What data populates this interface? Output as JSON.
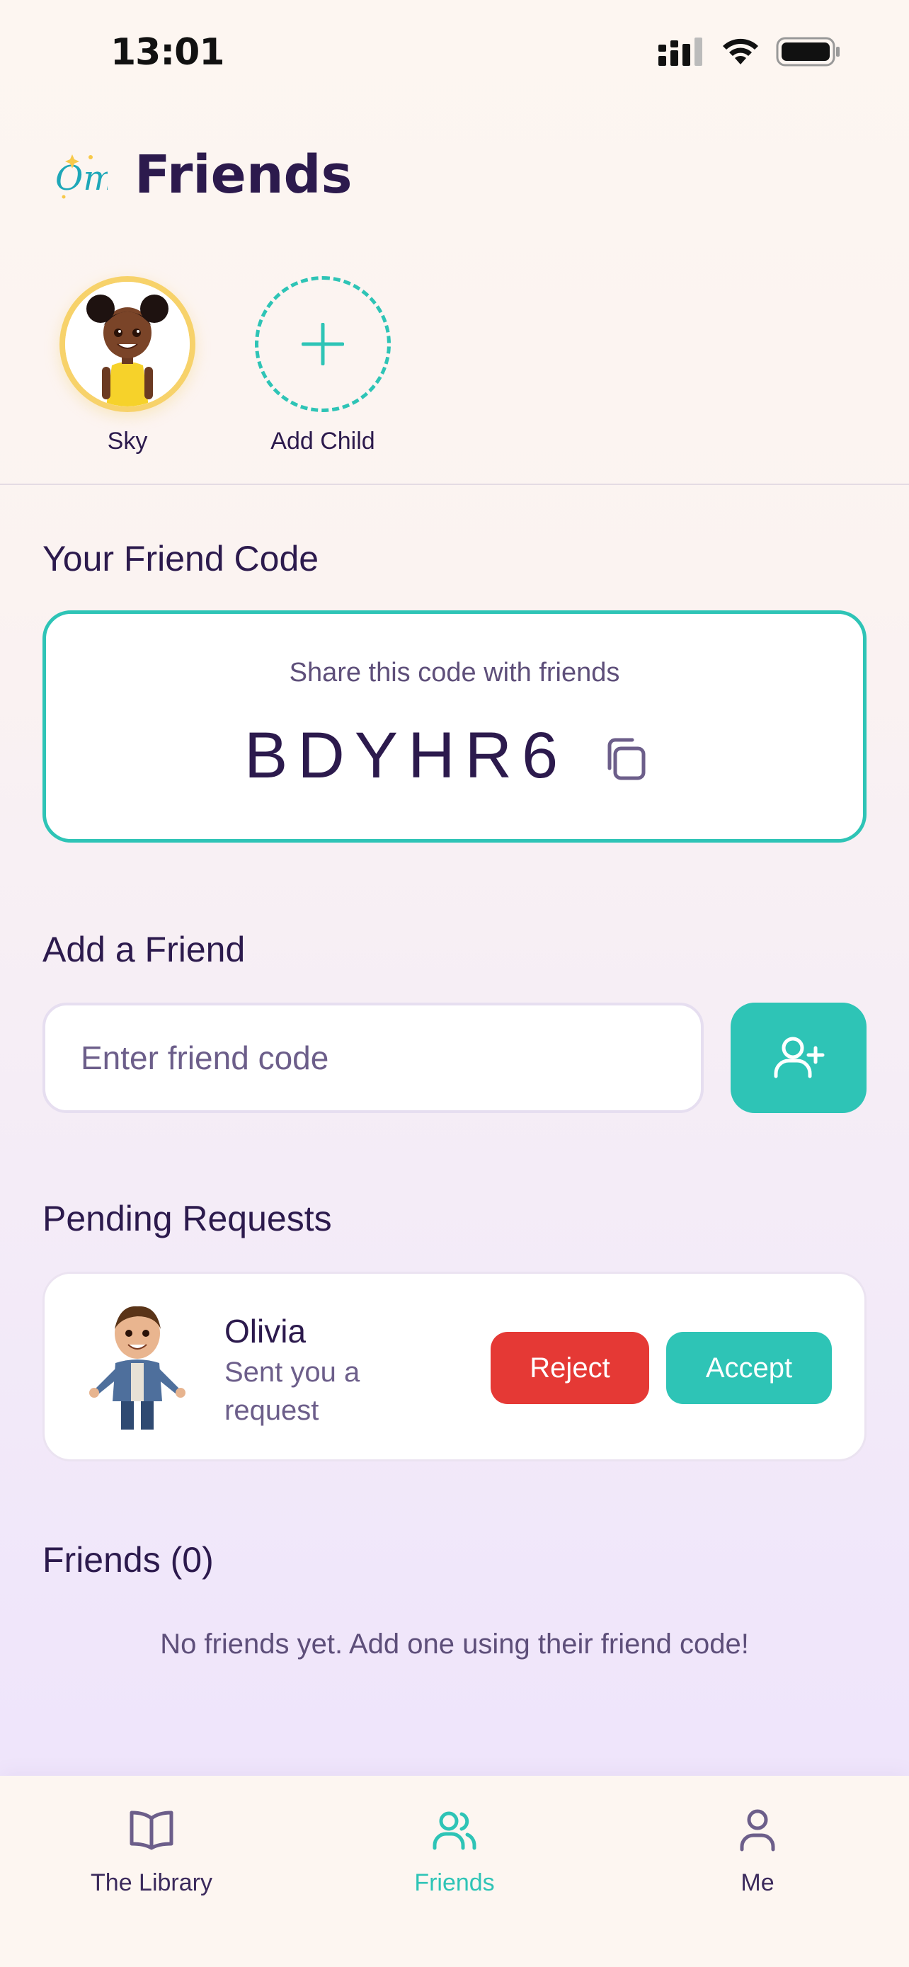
{
  "status_bar": {
    "time": "13:01"
  },
  "header": {
    "title": "Friends",
    "logo_text": "Om"
  },
  "children": {
    "items": [
      {
        "name": "Sky"
      }
    ],
    "add_label": "Add Child"
  },
  "friend_code": {
    "section_title": "Your Friend Code",
    "caption": "Share this code with friends",
    "code": "BDYHR6"
  },
  "add_friend": {
    "section_title": "Add a Friend",
    "placeholder": "Enter friend code"
  },
  "pending": {
    "section_title": "Pending Requests",
    "requests": [
      {
        "name": "Olivia",
        "subtitle": "Sent you a request",
        "reject_label": "Reject",
        "accept_label": "Accept"
      }
    ]
  },
  "friends": {
    "section_title": "Friends (0)",
    "empty_message": "No friends yet. Add one using their friend code!"
  },
  "tab_bar": {
    "tabs": [
      {
        "label": "The Library",
        "icon": "book-icon"
      },
      {
        "label": "Friends",
        "icon": "users-icon",
        "active": true
      },
      {
        "label": "Me",
        "icon": "user-icon"
      }
    ]
  },
  "colors": {
    "accent": "#2ec4b6",
    "reject": "#e53935",
    "text": "#2c1a4d",
    "avatar_ring": "#f7d26a"
  }
}
